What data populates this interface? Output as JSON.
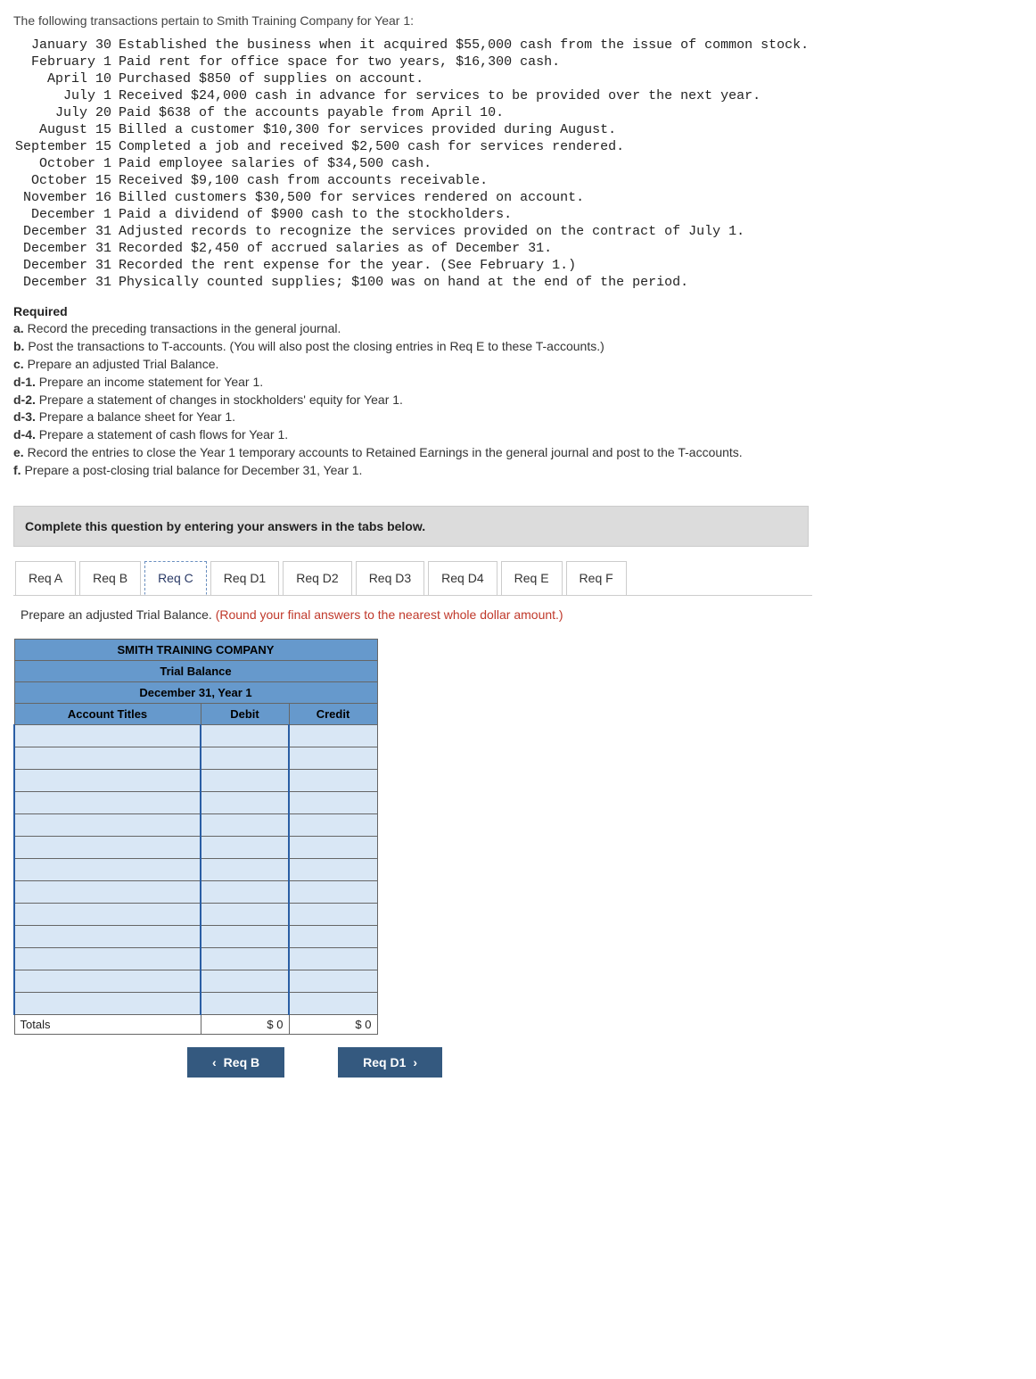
{
  "intro": "The following transactions pertain to Smith Training Company for Year 1:",
  "transactions": [
    {
      "date": "January 30",
      "desc": "Established the business when it acquired $55,000 cash from the issue of common stock."
    },
    {
      "date": "February 1",
      "desc": "Paid rent for office space for two years, $16,300 cash."
    },
    {
      "date": "April 10",
      "desc": "Purchased $850 of supplies on account."
    },
    {
      "date": "July 1",
      "desc": "Received $24,000 cash in advance for services to be provided over the next year."
    },
    {
      "date": "July 20",
      "desc": "Paid $638 of the accounts payable from April 10."
    },
    {
      "date": "August 15",
      "desc": "Billed a customer $10,300 for services provided during August."
    },
    {
      "date": "September 15",
      "desc": "Completed a job and received $2,500 cash for services rendered."
    },
    {
      "date": "October 1",
      "desc": "Paid employee salaries of $34,500 cash."
    },
    {
      "date": "October 15",
      "desc": "Received $9,100 cash from accounts receivable."
    },
    {
      "date": "November 16",
      "desc": "Billed customers $30,500 for services rendered on account."
    },
    {
      "date": "December 1",
      "desc": "Paid a dividend of $900 cash to the stockholders."
    },
    {
      "date": "December 31",
      "desc": "Adjusted records to recognize the services provided on the contract of July 1."
    },
    {
      "date": "December 31",
      "desc": "Recorded $2,450 of accrued salaries as of December 31."
    },
    {
      "date": "December 31",
      "desc": "Recorded the rent expense for the year. (See February 1.)"
    },
    {
      "date": "December 31",
      "desc": "Physically counted supplies; $100 was on hand at the end of the period."
    }
  ],
  "required": {
    "title": "Required",
    "items": [
      {
        "label": "a.",
        "text": "Record the preceding transactions in the general journal."
      },
      {
        "label": "b.",
        "text": "Post the transactions to T-accounts. (You will also post the closing entries in Req E to these T-accounts.)"
      },
      {
        "label": "c.",
        "text": "Prepare an adjusted Trial Balance."
      },
      {
        "label": "d-1.",
        "text": "Prepare an income statement for Year 1."
      },
      {
        "label": "d-2.",
        "text": "Prepare a statement of changes in stockholders' equity for Year 1."
      },
      {
        "label": "d-3.",
        "text": "Prepare a balance sheet for Year 1."
      },
      {
        "label": "d-4.",
        "text": "Prepare a statement of cash flows for Year 1."
      },
      {
        "label": "e.",
        "text": "Record the entries to close the Year 1 temporary accounts to Retained Earnings in the general journal and post to the T-accounts."
      },
      {
        "label": "f.",
        "text": "Prepare a post-closing trial balance for December 31, Year 1."
      }
    ]
  },
  "banner": "Complete this question by entering your answers in the tabs below.",
  "tabs": [
    "Req A",
    "Req B",
    "Req C",
    "Req D1",
    "Req D2",
    "Req D3",
    "Req D4",
    "Req E",
    "Req F"
  ],
  "activeTabIndex": 2,
  "tabInstruction": {
    "main": "Prepare an adjusted Trial Balance. ",
    "red": "(Round your final answers to the nearest whole dollar amount.)"
  },
  "trialBalance": {
    "company": "SMITH TRAINING COMPANY",
    "title": "Trial Balance",
    "date": "December 31, Year 1",
    "col1": "Account Titles",
    "col2": "Debit",
    "col3": "Credit",
    "rows": 13,
    "totalsLabel": "Totals",
    "debitTotal": "$            0",
    "creditTotal": "$            0"
  },
  "nav": {
    "prev": "Req B",
    "next": "Req D1"
  }
}
